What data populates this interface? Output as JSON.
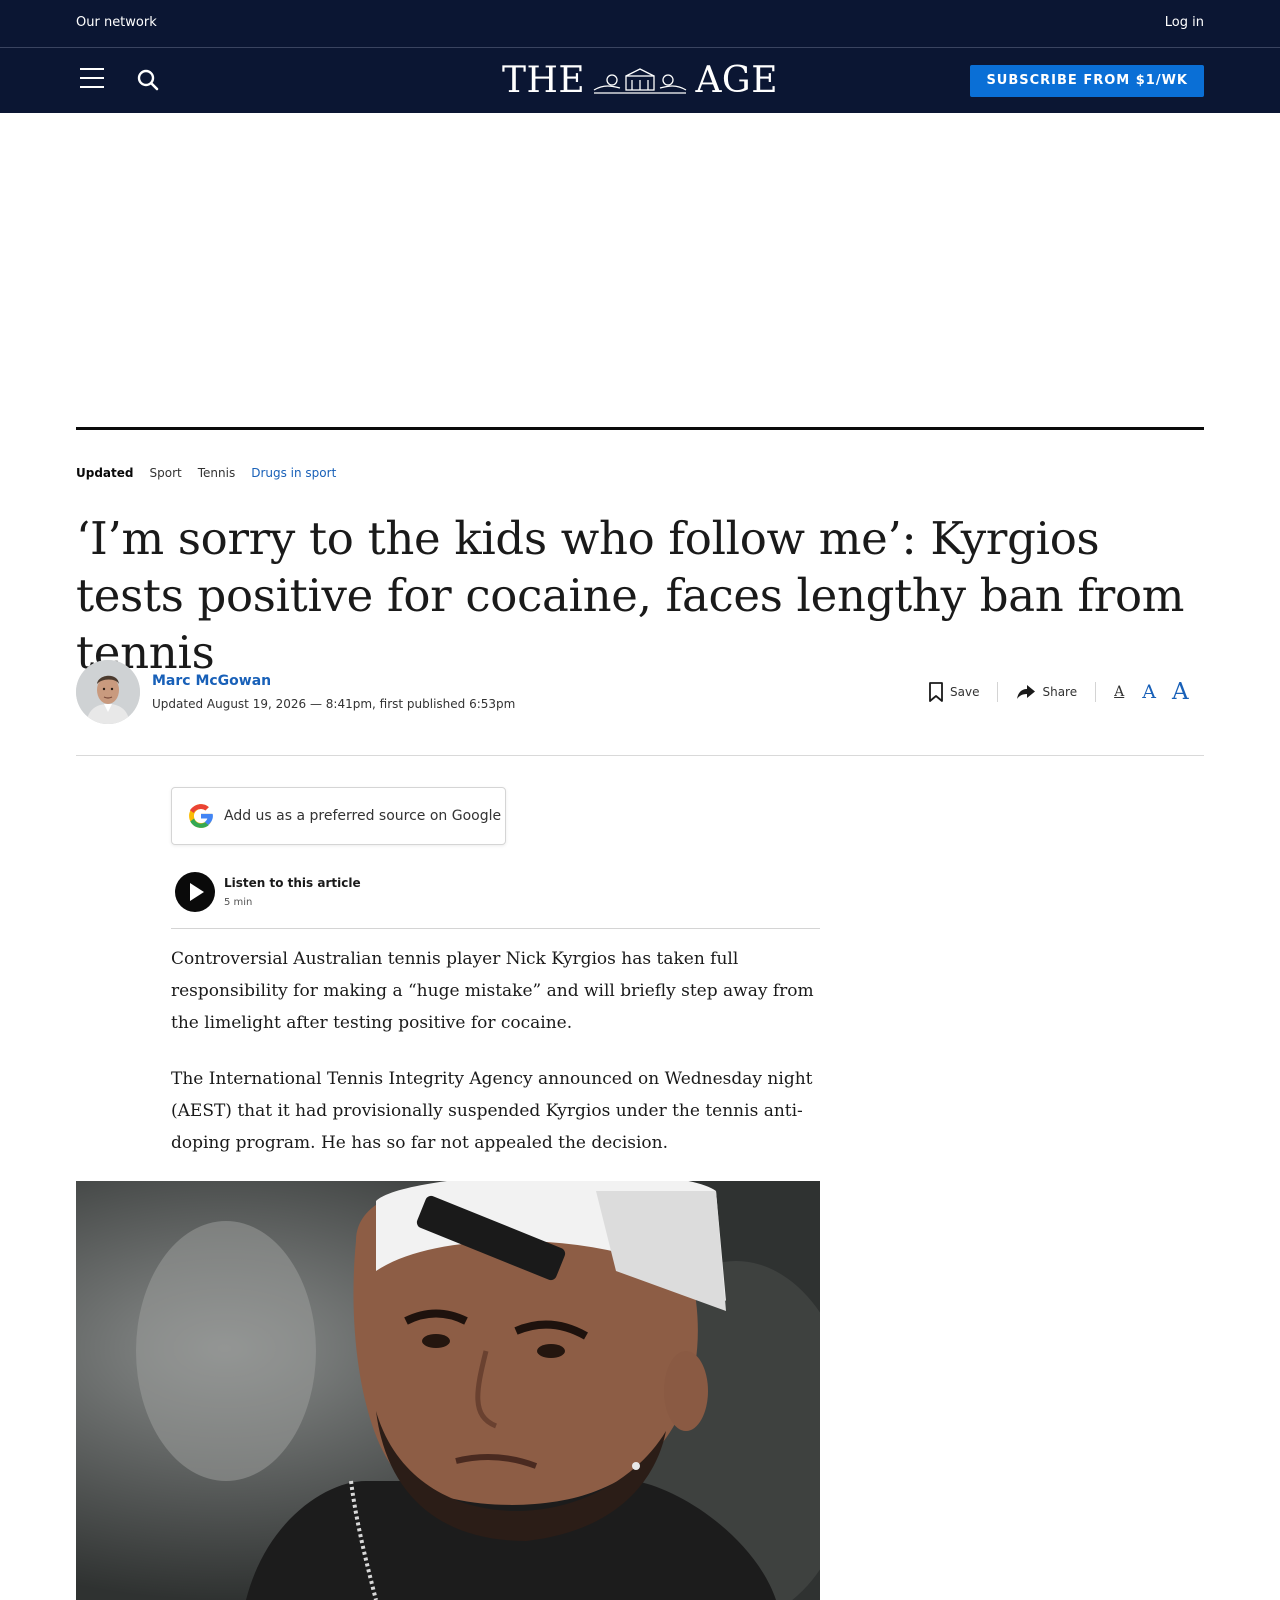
{
  "topbar": {
    "network": "Our network",
    "login": "Log in"
  },
  "masthead": {
    "logo_left": "THE",
    "logo_right": "AGE",
    "subscribe": "SUBSCRIBE FROM $1/WK"
  },
  "breadcrumb": {
    "status": "Updated",
    "items": [
      "Sport",
      "Tennis",
      "Drugs in sport"
    ]
  },
  "headline": "‘I’m sorry to the kids who follow me’: Kyrgios tests positive for cocaine, faces lengthy ban from tennis",
  "byline": {
    "author": "Marc McGowan",
    "timestamp": "Updated August 19, 2026 — 8:41pm, first published 6:53pm"
  },
  "tools": {
    "save": "Save",
    "share": "Share",
    "font_small": "A",
    "font_medium": "A",
    "font_large": "A"
  },
  "google": {
    "label": "Add us as a preferred source on Google"
  },
  "audio": {
    "title": "Listen to this article",
    "duration": "5 min"
  },
  "article": {
    "paragraphs": [
      "Controversial Australian tennis player Nick Kyrgios has taken full responsibility for making a “huge mistake” and will briefly step away from the limelight after testing positive for cocaine.",
      "The International Tennis Integrity Agency announced on Wednesday night (AEST) that it had provisionally suspended Kyrgios under the tennis anti-doping program. He has so far not appealed the decision."
    ]
  },
  "icons": {
    "menu": "menu-icon",
    "search": "search-icon",
    "save": "bookmark-icon",
    "share": "share-icon",
    "google": "google-g-icon",
    "play": "play-icon"
  },
  "colors": {
    "header_bg": "#0b1633",
    "accent": "#0a6fd6",
    "link": "#1860b8"
  }
}
